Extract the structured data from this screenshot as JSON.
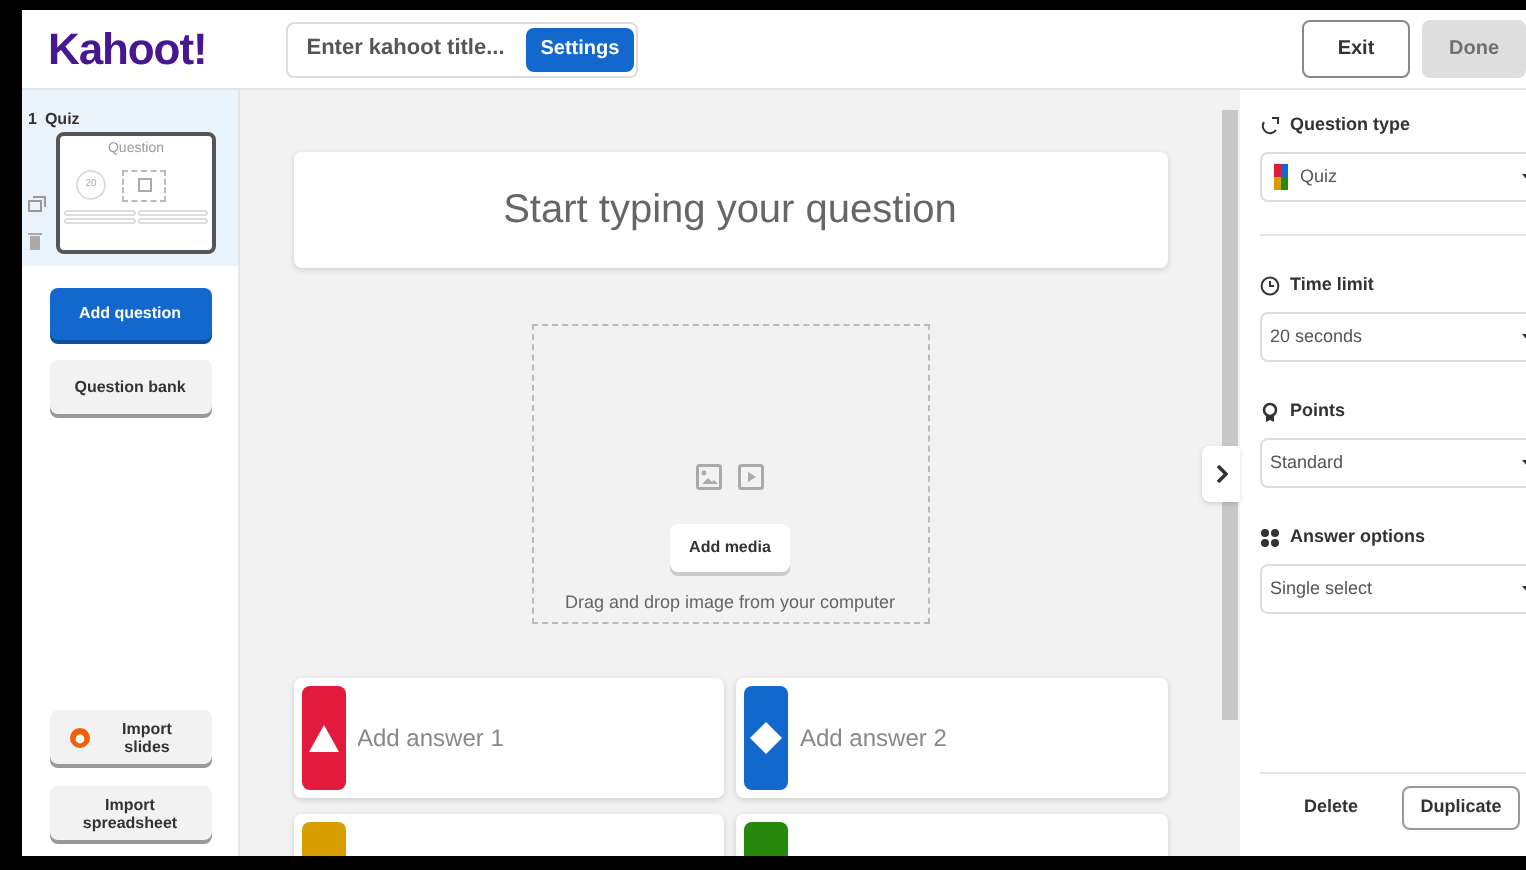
{
  "header": {
    "logo": "Kahoot!",
    "title_field": {
      "placeholder": "Enter kahoot title..."
    },
    "settings": "Settings",
    "exit": "Exit",
    "done": {
      "label": "Done",
      "disabled": true
    }
  },
  "sidebar": {
    "slides": [
      {
        "number": "1",
        "type": "Quiz",
        "preview_title": "Question",
        "timer": "20",
        "selected": true
      }
    ],
    "add_question": "Add question",
    "question_bank": "Question bank",
    "import_slides": "Import slides",
    "import_spreadsheet": "Import spreadsheet"
  },
  "editor": {
    "question": {
      "placeholder": "Start typing your question"
    },
    "media": {
      "button": "Add media",
      "hint": "Drag and drop image from your computer"
    },
    "answers": [
      {
        "placeholder": "Add answer 1",
        "kind": "triangle",
        "color": "#e21b3c"
      },
      {
        "placeholder": "Add answer 2",
        "kind": "diamond",
        "color": "#1368ce"
      },
      {
        "color": "#d89e00"
      },
      {
        "color": "#26890c"
      }
    ]
  },
  "settings_panel": {
    "sections": [
      {
        "kind": "question_type",
        "label": "Question type",
        "value": "Quiz"
      },
      {
        "kind": "time_limit",
        "label": "Time limit",
        "value": "20 seconds"
      },
      {
        "kind": "points",
        "label": "Points",
        "value": "Standard"
      },
      {
        "kind": "answer_options",
        "label": "Answer options",
        "value": "Single select"
      }
    ],
    "delete": "Delete",
    "duplicate": "Duplicate"
  }
}
